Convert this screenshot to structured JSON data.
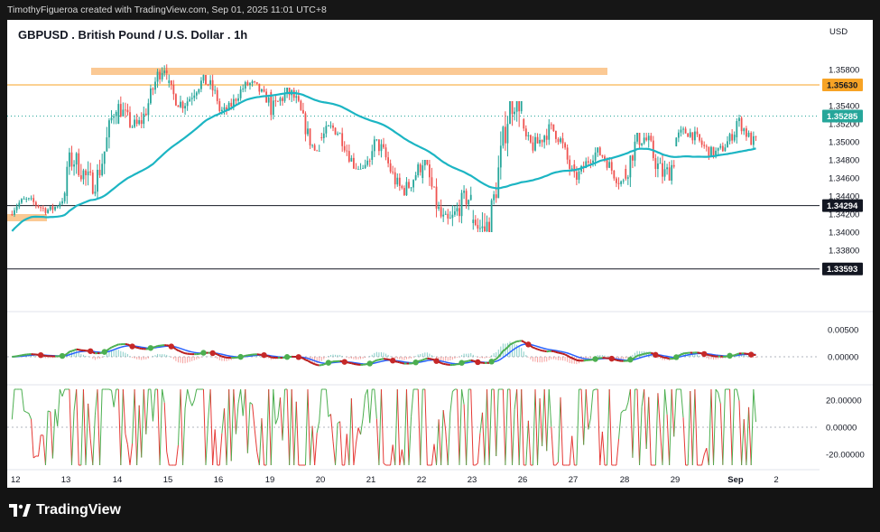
{
  "header": {
    "credit": "TimothyFigueroa created with TradingView.com, Sep 01, 2025 11:01 UTC+8"
  },
  "footer": {
    "brand": "TradingView"
  },
  "chart_data": {
    "type": "candlestick",
    "title": "GBPUSD . British Pound / U.S. Dollar . 1h",
    "currency": "USD",
    "price_axis": {
      "ticks": [
        "1.35800",
        "1.35400",
        "1.35200",
        "1.35000",
        "1.34800",
        "1.34600",
        "1.34400",
        "1.34200",
        "1.34000",
        "1.33800"
      ],
      "range": [
        1.3325,
        1.3605
      ]
    },
    "time_axis": [
      "12",
      "13",
      "14",
      "15",
      "16",
      "19",
      "20",
      "21",
      "22",
      "23",
      "26",
      "27",
      "28",
      "29",
      "Sep",
      "2"
    ],
    "price_levels": [
      {
        "label": "1.35630",
        "value": 1.3563,
        "color": "#f7a325",
        "text_color": "#131722"
      },
      {
        "label": "1.35285",
        "value": 1.35285,
        "color": "#26a69a",
        "text_color": "#ffffff"
      },
      {
        "label": "1.34294",
        "value": 1.34294,
        "color": "#131722",
        "text_color": "#ffffff"
      },
      {
        "label": "1.33593",
        "value": 1.33593,
        "color": "#131722",
        "text_color": "#ffffff"
      }
    ],
    "zones": [
      {
        "from": "13",
        "to": "29",
        "value": 1.3578,
        "color": "#fbc994"
      },
      {
        "from": "12",
        "to": "12",
        "value": 1.3416,
        "color": "#fbc994"
      }
    ],
    "moving_average": {
      "color": "#1cb5c3"
    },
    "daily_ohlc": [
      {
        "date": "12",
        "o": 1.342,
        "h": 1.3445,
        "l": 1.341,
        "c": 1.344
      },
      {
        "date": "13",
        "o": 1.344,
        "h": 1.3535,
        "l": 1.343,
        "c": 1.352
      },
      {
        "date": "14",
        "o": 1.352,
        "h": 1.359,
        "l": 1.3515,
        "c": 1.3565
      },
      {
        "date": "15",
        "o": 1.3565,
        "h": 1.358,
        "l": 1.352,
        "c": 1.3545
      },
      {
        "date": "16",
        "o": 1.3545,
        "h": 1.3575,
        "l": 1.353,
        "c": 1.3555
      },
      {
        "date": "19",
        "o": 1.3555,
        "h": 1.356,
        "l": 1.349,
        "c": 1.3505
      },
      {
        "date": "20",
        "o": 1.3505,
        "h": 1.353,
        "l": 1.347,
        "c": 1.348
      },
      {
        "date": "21",
        "o": 1.348,
        "h": 1.351,
        "l": 1.344,
        "c": 1.346
      },
      {
        "date": "22",
        "o": 1.346,
        "h": 1.348,
        "l": 1.339,
        "c": 1.341
      },
      {
        "date": "23",
        "o": 1.341,
        "h": 1.3545,
        "l": 1.34,
        "c": 1.3525
      },
      {
        "date": "26",
        "o": 1.3525,
        "h": 1.353,
        "l": 1.346,
        "c": 1.3475
      },
      {
        "date": "27",
        "o": 1.3475,
        "h": 1.3495,
        "l": 1.344,
        "c": 1.347
      },
      {
        "date": "28",
        "o": 1.347,
        "h": 1.351,
        "l": 1.3415,
        "c": 1.3495
      },
      {
        "date": "29",
        "o": 1.3495,
        "h": 1.353,
        "l": 1.348,
        "c": 1.3505
      },
      {
        "date": "Sep",
        "o": 1.3505,
        "h": 1.353,
        "l": 1.347,
        "c": 1.3528
      }
    ],
    "macd_axis": {
      "ticks": [
        "0.00500",
        "0.00000"
      ]
    },
    "oscillator_axis": {
      "ticks": [
        "20.00000",
        "0.00000",
        "-20.00000"
      ],
      "range": [
        -30,
        30
      ]
    },
    "colors": {
      "up": "#26a69a",
      "down": "#ef5350"
    }
  }
}
